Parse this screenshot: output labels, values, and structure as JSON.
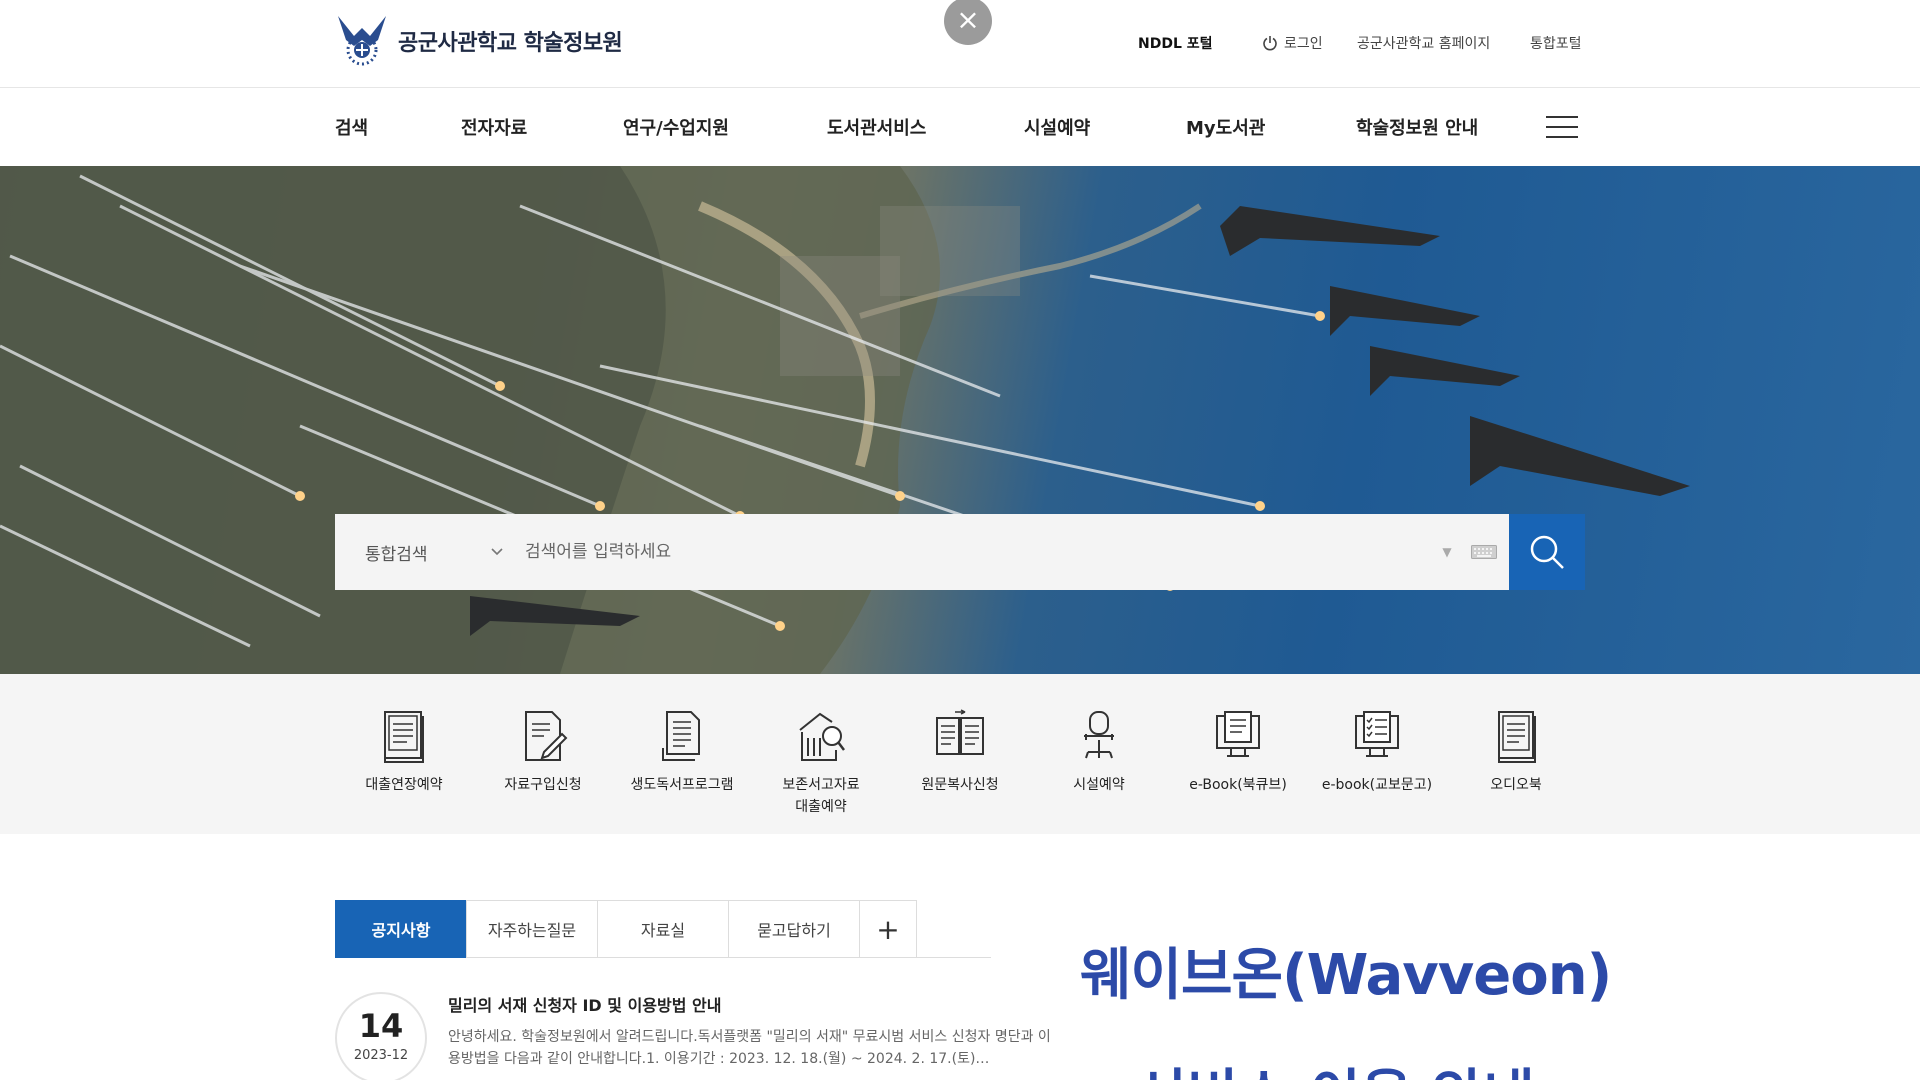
{
  "header": {
    "site_title": "공군사관학교 학술정보원",
    "utility_links": {
      "nddl": "NDDL 포털",
      "login": "로그인",
      "homepage": "공군사관학교 홈페이지",
      "portal": "통합포털"
    },
    "close_symbol": "×"
  },
  "gnb": [
    "검색",
    "전자자료",
    "연구/수업지원",
    "도서관서비스",
    "시설예약",
    "My도서관",
    "학술정보원 안내"
  ],
  "search": {
    "scope": "통합검색",
    "placeholder": "검색어를 입력하세요"
  },
  "quick_menu": [
    {
      "label": "대출연장예약",
      "icon": "book-icon"
    },
    {
      "label": "자료구입신청",
      "icon": "document-pen-icon"
    },
    {
      "label": "생도독서프로그램",
      "icon": "document-icon"
    },
    {
      "label": "보존서고자료\n대출예약",
      "icon": "archive-search-icon"
    },
    {
      "label": "원문복사신청",
      "icon": "copy-icon"
    },
    {
      "label": "시설예약",
      "icon": "chair-icon"
    },
    {
      "label": "e-Book(북큐브)",
      "icon": "ebook-icon"
    },
    {
      "label": "e-book(교보문고)",
      "icon": "ebook-checklist-icon"
    },
    {
      "label": "오디오북",
      "icon": "audiobook-icon"
    }
  ],
  "board_tabs": [
    "공지사항",
    "자주하는질문",
    "자료실",
    "묻고답하기"
  ],
  "board_more_symbol": "+",
  "notice": {
    "day": "14",
    "year_month": "2023-12",
    "title": "밀리의 서재 신청자 ID 및 이용방법 안내",
    "desc": "안녕하세요. 학술정보원에서 알려드립니다.독서플랫폼 \"밀리의 서재\" 무료시범 서비스 신청자 명단과 이용방법을 다음과 같이 안내합니다.1. 이용기간 : 2023. 12. 18.(월) ~ 2024. 2. 17.(토)…"
  },
  "banner": {
    "line1": "웨이브온(Wavveon)",
    "line2": "서비스 이용 안내"
  },
  "colors": {
    "primary": "#1864b5",
    "banner_text": "#2c4aa8"
  }
}
